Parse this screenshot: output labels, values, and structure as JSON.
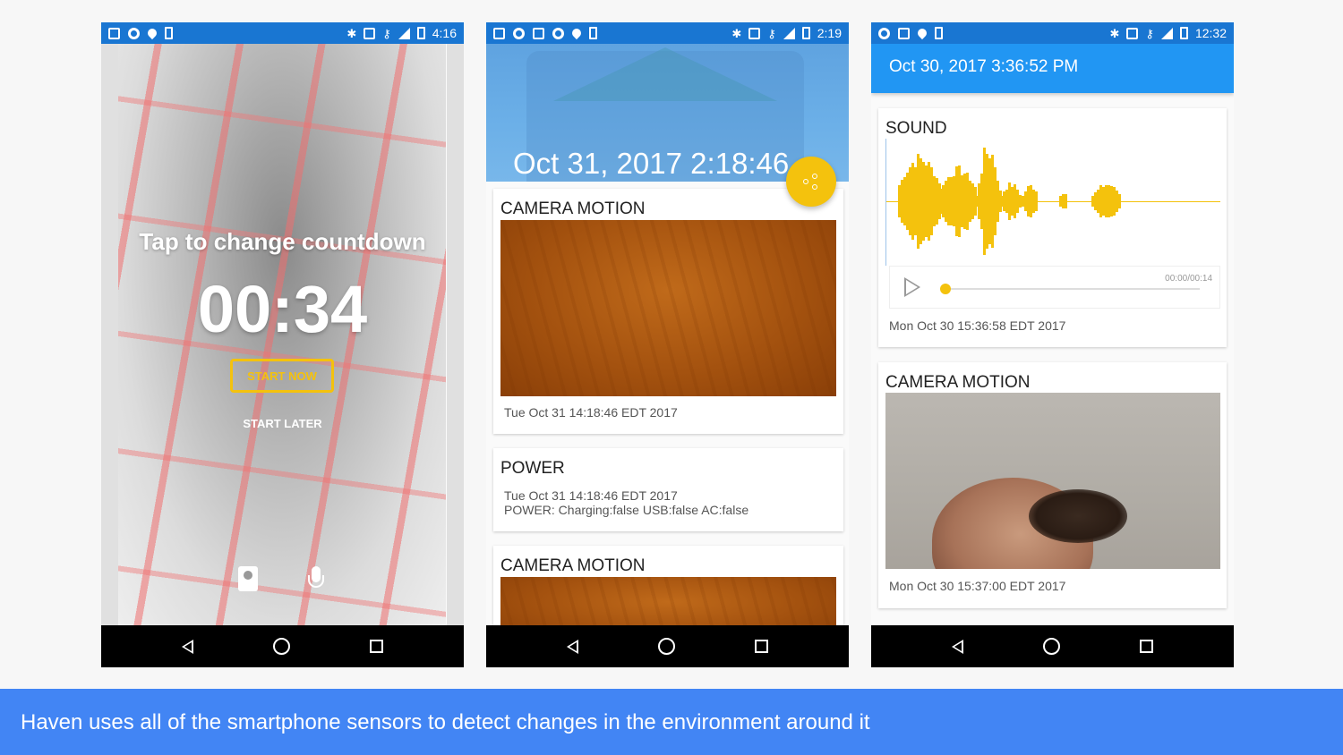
{
  "colors": {
    "accent": "#f4c20d",
    "statusbar": "#1976d2",
    "appbar": "#2196f3",
    "caption": "#4285f4"
  },
  "phone1": {
    "status_time": "4:16",
    "instruction": "Tap to change countdown",
    "countdown": "00:34",
    "start_now": "START NOW",
    "start_later": "START LATER",
    "icons": [
      "camera-switch-icon",
      "microphone-icon"
    ]
  },
  "phone2": {
    "status_time": "2:19",
    "header_title": "Oct 31, 2017 2:18:46…",
    "cards": [
      {
        "title": "CAMERA MOTION",
        "meta": "Tue Oct 31 14:18:46 EDT 2017"
      },
      {
        "title": "POWER",
        "meta": "Tue Oct 31 14:18:46 EDT 2017",
        "detail": "POWER: Charging:false USB:false AC:false"
      },
      {
        "title": "CAMERA MOTION"
      }
    ]
  },
  "phone3": {
    "status_time": "12:32",
    "appbar_title": "Oct 30, 2017 3:36:52 PM",
    "sound_card": {
      "title": "SOUND",
      "time": "00:00/00:14",
      "meta": "Mon Oct 30 15:36:58 EDT 2017"
    },
    "camera_card": {
      "title": "CAMERA MOTION",
      "meta": "Mon Oct 30 15:37:00 EDT 2017"
    }
  },
  "caption": "Haven uses all of the smartphone sensors to detect changes in the environment around it"
}
